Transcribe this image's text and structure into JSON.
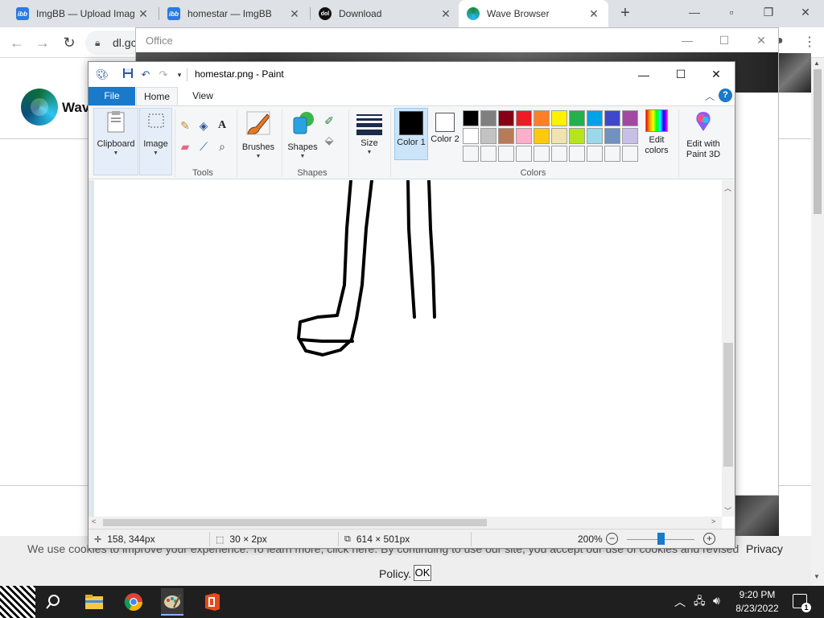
{
  "browser": {
    "tabs": [
      {
        "label": "ImgBB — Upload Imag",
        "favicon": "ibb"
      },
      {
        "label": "homestar — ImgBB",
        "favicon": "ibb"
      },
      {
        "label": "Download",
        "favicon": "dol"
      },
      {
        "label": "Wave Browser",
        "favicon": "wave"
      }
    ],
    "url": "dl.gc",
    "favicon_text_ibb": "ibb",
    "favicon_text_dol": "dol"
  },
  "page": {
    "brand": "Wave",
    "cookie_text": "We use cookies to improve your experience. To learn more, click here. By continuing to use our site, you accept our use of cookies and revised",
    "privacy": "Privacy",
    "policy": "Policy.",
    "ok": "OK"
  },
  "office": {
    "title": "Office"
  },
  "paint": {
    "title": "homestar.png - Paint",
    "tabs": {
      "file": "File",
      "home": "Home",
      "view": "View"
    },
    "groups": {
      "clipboard": "Clipboard",
      "image": "Image",
      "tools": "Tools",
      "brushes": "Brushes",
      "shapes_btn": "Shapes",
      "shapes": "Shapes",
      "size": "Size",
      "color1": "Color 1",
      "color2": "Color 2",
      "colors": "Colors",
      "edit_colors": "Edit colors",
      "paint3d": "Edit with Paint 3D"
    },
    "color1": "#000000",
    "color2": "#ffffff",
    "palette_row1": [
      "#000000",
      "#7f7f7f",
      "#880015",
      "#ed1c24",
      "#ff7f27",
      "#fff200",
      "#22b14c",
      "#00a2e8",
      "#3f48cc",
      "#a349a4"
    ],
    "palette_row2": [
      "#ffffff",
      "#c3c3c3",
      "#b97a57",
      "#ffaec9",
      "#ffc90e",
      "#efe4b0",
      "#b5e61d",
      "#99d9ea",
      "#7092be",
      "#c8bfe7"
    ],
    "status": {
      "cursor": "158, 344px",
      "selection": "30 × 2px",
      "image_size": "614 × 501px",
      "zoom": "200%",
      "zoom_fraction": 0.5
    }
  },
  "taskbar": {
    "time": "9:20 PM",
    "date": "8/23/2022",
    "notifications": "1"
  }
}
